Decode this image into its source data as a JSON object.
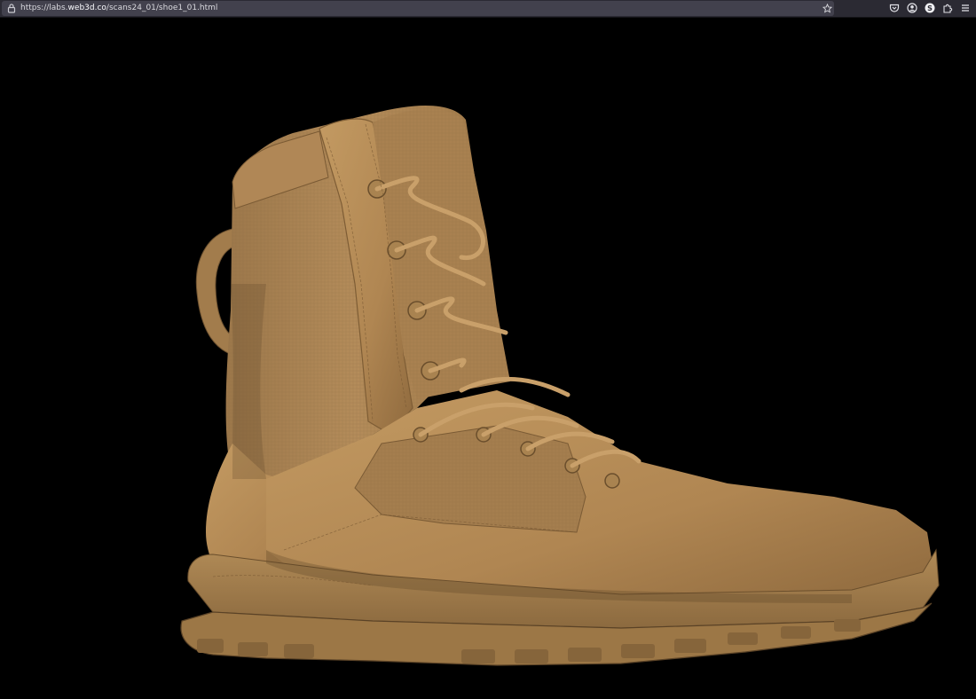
{
  "browser": {
    "url_prefix": "https://labs.",
    "url_host": "web3d.co",
    "url_path": "/scans24_01/shoe1_01.html",
    "icons": [
      "lock-icon",
      "bookmark-star-icon",
      "pocket-icon",
      "account-icon",
      "extension-s-icon",
      "extensions-puzzle-icon",
      "menu-icon"
    ]
  },
  "scene": {
    "subject": "boot-3d-scan",
    "colors": {
      "background": "#000000",
      "suede": "#b38a55",
      "fabric": "#a98150",
      "sole": "#a07a48",
      "shadow": "#5a4226"
    }
  }
}
